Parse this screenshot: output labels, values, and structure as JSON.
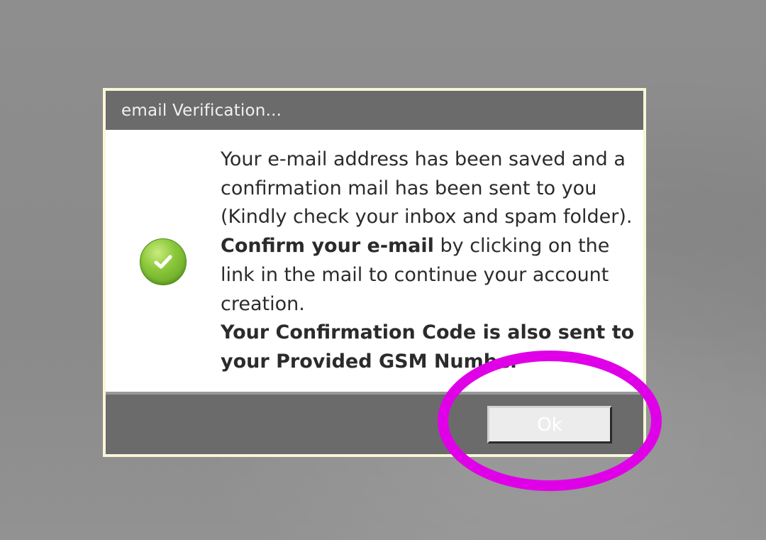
{
  "dialog": {
    "title": "email Verification...",
    "icon": "success-check-icon",
    "message": {
      "line1": "Your e-mail address has been saved and a confirmation mail has been sent to you (Kindly check your inbox and spam folder).",
      "confirm_bold": "Confirm your e-mail",
      "confirm_rest": " by clicking on the link in the mail to continue your account creation.",
      "code_bold": "Your Confirmation Code is also sent to your Provided GSM Number"
    },
    "ok_label": "Ok"
  },
  "colors": {
    "title_bar": "#6b6b6b",
    "dialog_frame": "#f7f7d6",
    "highlight": "#e000e8",
    "success_green": "#7cba2e"
  }
}
